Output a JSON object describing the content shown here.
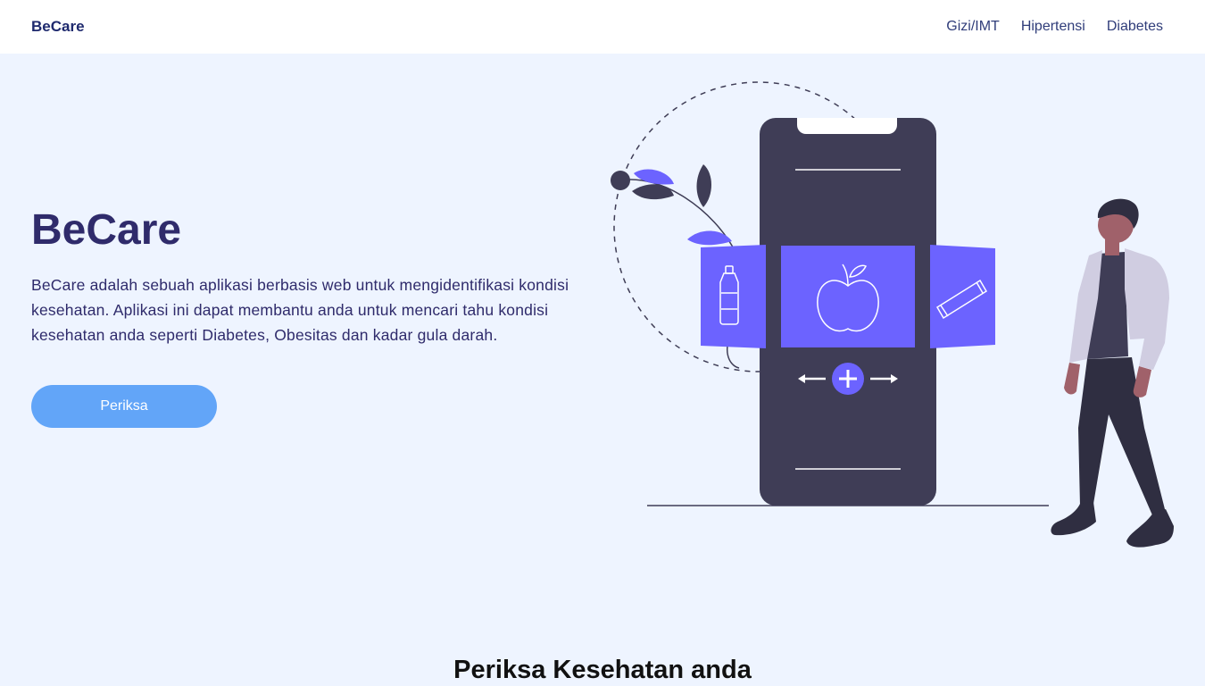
{
  "nav": {
    "brand": "BeCare",
    "links": [
      "Gizi/IMT",
      "Hipertensi",
      "Diabetes"
    ]
  },
  "hero": {
    "title": "BeCare",
    "description": "BeCare adalah sebuah aplikasi berbasis web untuk mengidentifikasi kondisi kesehatan. Aplikasi ini dapat membantu anda untuk mencari tahu kondisi kesehatan anda seperti Diabetes, Obesitas dan kadar gula darah.",
    "cta_label": "Periksa"
  },
  "section": {
    "title": "Periksa Kesehatan anda"
  },
  "colors": {
    "accent": "#6c63ff",
    "button": "#62a5f8",
    "dark": "#3f3d56",
    "background": "#eef4ff",
    "heading": "#2f2b6b"
  },
  "icons": [
    "bottle-icon",
    "apple-icon",
    "snack-bar-icon",
    "plus-icon",
    "arrow-left-icon",
    "arrow-right-icon"
  ]
}
